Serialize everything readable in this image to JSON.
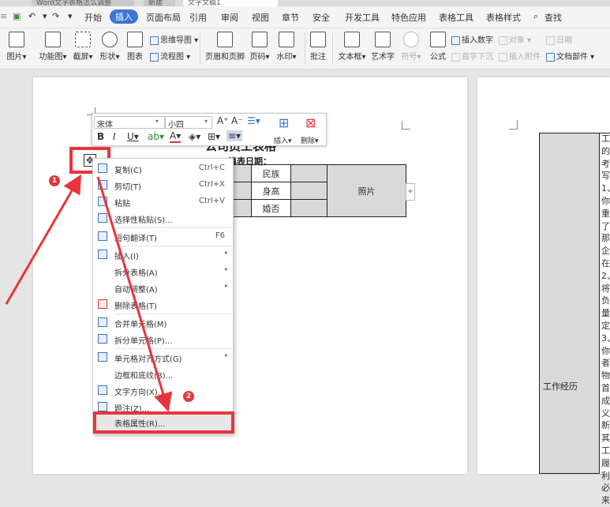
{
  "tabs": [
    {
      "label": "Word文字表格怎么调整"
    },
    {
      "label": "新建"
    },
    {
      "label": "文字文稿1"
    }
  ],
  "menu": {
    "items": [
      "开始",
      "插入",
      "页面布局",
      "引用",
      "审阅",
      "视图",
      "章节",
      "安全",
      "开发工具",
      "特色应用",
      "表格工具",
      "表格样式"
    ],
    "active": "插入",
    "search": "查找"
  },
  "ribbon": {
    "big": [
      "图片",
      "功能图",
      "截屏",
      "形状",
      "图表",
      "页眉和页脚",
      "页码",
      "水印",
      "批注",
      "文本框",
      "艺术字",
      "符号",
      "公式"
    ],
    "small": [
      "思维导图",
      "流程图",
      "插入数字",
      "首字下沉",
      "对象",
      "插入附件",
      "日期",
      "文档部件"
    ]
  },
  "minibar": {
    "font": "宋体",
    "size": "小四",
    "insert": "插入",
    "delete": "删除"
  },
  "document": {
    "title": "公司员工表格",
    "date_label": "填表日期：",
    "cells": {
      "ethnicity": "民族",
      "height": "身高",
      "marital": "婚否",
      "photo": "照片",
      "work_history": "工作经历"
    },
    "page2_text": "工的考写1、你重了那企在2、将负量定3、你者物首成义新其工履利必来"
  },
  "context_menu": {
    "items": [
      {
        "label": "复制(C)",
        "shortcut": "Ctrl+C"
      },
      {
        "label": "剪切(T)",
        "shortcut": "Ctrl+X"
      },
      {
        "label": "粘贴",
        "shortcut": "Ctrl+V"
      },
      {
        "label": "选择性粘贴(S)...",
        "shortcut": ""
      },
      {
        "label": "短句翻译(T)",
        "shortcut": "F6"
      },
      {
        "label": "插入(I)",
        "shortcut": ""
      },
      {
        "label": "拆分表格(A)",
        "shortcut": ""
      },
      {
        "label": "自动调整(A)",
        "shortcut": ""
      },
      {
        "label": "删除表格(T)",
        "shortcut": ""
      },
      {
        "label": "合并单元格(M)",
        "shortcut": ""
      },
      {
        "label": "拆分单元格(P)...",
        "shortcut": ""
      },
      {
        "label": "单元格对齐方式(G)",
        "shortcut": ""
      },
      {
        "label": "边框和底纹(B)...",
        "shortcut": ""
      },
      {
        "label": "文字方向(X)...",
        "shortcut": ""
      },
      {
        "label": "题注(Z)...",
        "shortcut": ""
      },
      {
        "label": "表格属性(R)...",
        "shortcut": ""
      }
    ]
  },
  "annotations": {
    "step1": "1",
    "step2": "2"
  },
  "colors": {
    "accent": "#3b75d6",
    "annotation": "#e8353b"
  }
}
